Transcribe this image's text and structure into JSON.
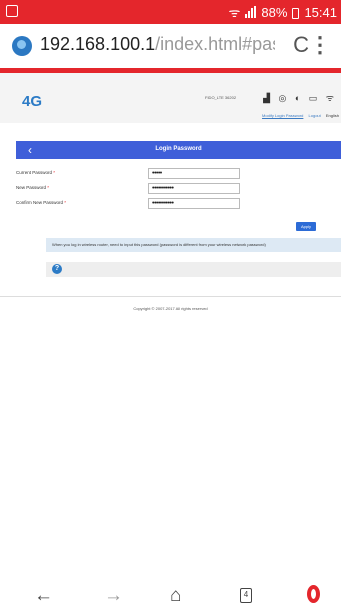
{
  "status_bar": {
    "battery": "88%",
    "time": "15:41"
  },
  "url_bar": {
    "host": "192.168.100.1",
    "path": "/index.html#passwo",
    "reload_icon": "C",
    "menu_icon": "⋮"
  },
  "router_header": {
    "logo": "4G",
    "network": "FIDO_LTE  36202",
    "links": [
      "Modify Login Password",
      "Logout",
      "English"
    ]
  },
  "page": {
    "title": "Login Password",
    "back_icon": "‹"
  },
  "form": {
    "current_password_label": "Current Password",
    "current_password_value": "•••••",
    "new_password_label": "New Password",
    "new_password_value": "•••••••••••",
    "confirm_password_label": "Confirm New Password",
    "confirm_password_value": "•••••••••••",
    "required_mark": "*",
    "apply_label": "Apply"
  },
  "info_text": "When you log in wireless router, need to input this password (password is different from your wireless network password)",
  "help_icon": "?",
  "footer": {
    "copyright": "Copyright © 2007-2017 All rights reserved"
  },
  "nav_bar": {
    "back_icon": "←",
    "forward_icon": "→",
    "home_icon": "⌂",
    "tabs_count": "4"
  }
}
